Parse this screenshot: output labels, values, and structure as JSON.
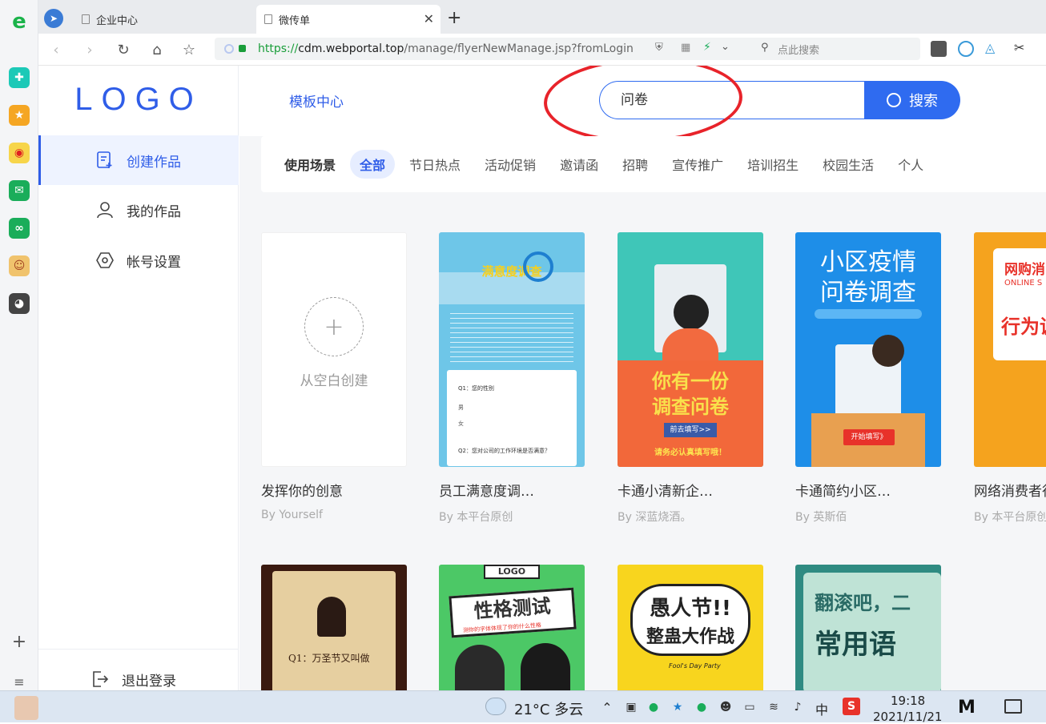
{
  "browser": {
    "tabs": [
      {
        "label": "企业中心"
      },
      {
        "label": "微传单"
      }
    ],
    "url": {
      "scheme": "https://",
      "host": "cdm.webportal.top",
      "path": "/manage/flyerNewManage.jsp?fromLogin"
    },
    "search_placeholder": "点此搜索"
  },
  "sidebar": {
    "logo": "LOGO",
    "items": [
      {
        "label": "创建作品"
      },
      {
        "label": "我的作品"
      },
      {
        "label": "帐号设置"
      }
    ],
    "logout": "退出登录"
  },
  "header": {
    "template_center": "模板中心",
    "search_value": "问卷",
    "search_button": "搜索"
  },
  "filter": {
    "label": "使用场景",
    "chips": [
      "全部",
      "节日热点",
      "活动促销",
      "邀请函",
      "招聘",
      "宣传推广",
      "培训招生",
      "校园生活",
      "个人"
    ]
  },
  "blank_card": {
    "label": "从空白创建",
    "title": "发挥你的创意",
    "author": "By Yourself"
  },
  "cards_row1": [
    {
      "title": "员工满意度调…",
      "author": "By 本平台原创",
      "poster": "满意度调查",
      "q1": "Q1：您的性别",
      "opt1": "男",
      "opt2": "女",
      "q2": "Q2：您对公司的工作环境是否满意？"
    },
    {
      "title": "卡通小清新企…",
      "author": "By 深蓝烧酒。",
      "poster_line1": "你有一份",
      "poster_line2": "调查问卷",
      "button": "前去填写>>",
      "footer": "请务必认真填写哦！"
    },
    {
      "title": "卡通简约小区…",
      "author": "By 英斯佰",
      "poster_line1": "小区疫情",
      "poster_line2": "问卷调查",
      "button": "开始填写》"
    },
    {
      "title": "网络消费者行",
      "author": "By 本平台原创",
      "poster_line1": "网购消",
      "poster_line2": "ONLINE S",
      "poster_line3": "行为调"
    }
  ],
  "cards_row2": [
    {
      "poster": "Q1：万圣节又叫做"
    },
    {
      "poster_top": "LOGO",
      "poster": "性格测试",
      "sub": "测你的字体体现了你的什么性格"
    },
    {
      "poster_line1": "愚人节!!",
      "poster_line2": "整蛊大作战",
      "sub": "Fool's Day Party"
    },
    {
      "poster_line1": "翻滚吧，二",
      "poster_line2": "常用语"
    }
  ],
  "taskbar": {
    "weather": "21°C 多云",
    "ime": "中",
    "time": "19:18",
    "date": "2021/11/21"
  },
  "colors": {
    "accent": "#2f6bf0",
    "brand_logo": "#2f5de8",
    "annotation": "#e8232a"
  }
}
